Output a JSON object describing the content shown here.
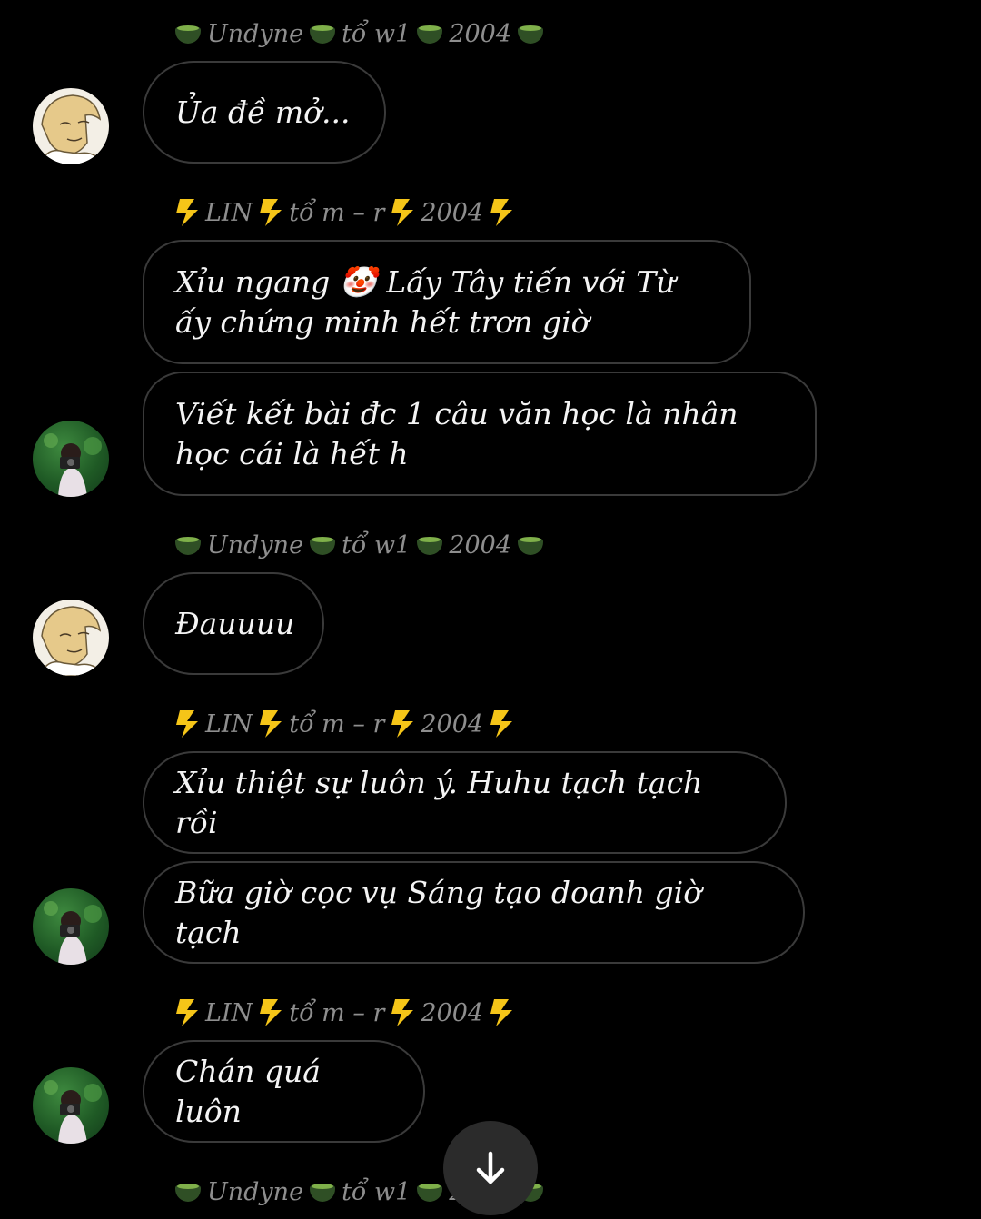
{
  "messages": [
    {
      "sender": {
        "name": "Undyne",
        "mid": "tổ w1",
        "year": "2004",
        "deco": "tea"
      },
      "bubbles": [
        "Ủa đề mở..."
      ],
      "avatar": "sketch-avatar"
    },
    {
      "sender": {
        "name": "LIN",
        "mid": "tổ m – r",
        "year": "2004",
        "deco": "bolt"
      },
      "bubbles": [
        "Xỉu ngang 🤡 Lấy Tây tiến với Từ ấy chứng minh hết trơn giờ",
        "Viết kết bài đc 1 câu văn học là nhân học cái là hết h"
      ],
      "avatar": "photo-avatar"
    },
    {
      "sender": {
        "name": "Undyne",
        "mid": "tổ w1",
        "year": "2004",
        "deco": "tea"
      },
      "bubbles": [
        "Đauuuu"
      ],
      "avatar": "sketch-avatar"
    },
    {
      "sender": {
        "name": "LIN",
        "mid": "tổ m – r",
        "year": "2004",
        "deco": "bolt"
      },
      "bubbles": [
        "Xỉu thiệt sự luôn ý. Huhu tạch tạch rồi",
        "Bữa giờ cọc vụ Sáng tạo doanh giờ tạch"
      ],
      "avatar": "photo-avatar"
    },
    {
      "sender": {
        "name": "LIN",
        "mid": "tổ m – r",
        "year": "2004",
        "deco": "bolt"
      },
      "bubbles": [
        "Chán quá luôn"
      ],
      "avatar": "photo-avatar"
    },
    {
      "sender": {
        "name": "Undyne",
        "mid": "tổ w1",
        "year": "2004",
        "deco": "tea"
      },
      "bubbles": [],
      "avatar": ""
    }
  ],
  "scroll_button": {
    "icon": "arrow-down-icon"
  },
  "colors": {
    "background": "#000000",
    "bubble_border": "#3a3a3a",
    "sender_text": "#8e8e8e",
    "bolt": "#f5c518",
    "tea": "#7fb04a"
  }
}
